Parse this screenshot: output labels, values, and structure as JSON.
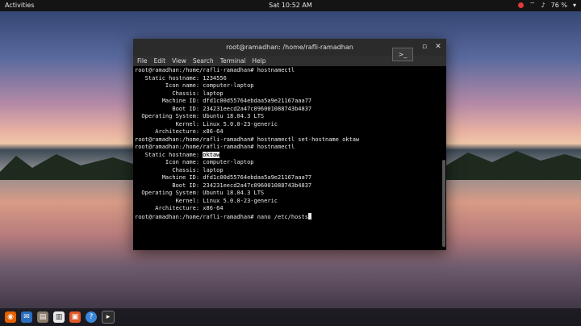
{
  "topbar": {
    "activities": "Activities",
    "clock": "Sat 10:52 AM",
    "battery": "76 %"
  },
  "window": {
    "title": "root@ramadhan: /home/rafli-ramadhan",
    "menu": [
      "File",
      "Edit",
      "View",
      "Search",
      "Terminal",
      "Help"
    ]
  },
  "terminal": {
    "lines": [
      "root@ramadhan:/home/rafli-ramadhan# hostnamectl",
      "   Static hostname: 1234556",
      "         Icon name: computer-laptop",
      "           Chassis: laptop",
      "        Machine ID: dfd1c00d55764ebdaa5a9e21167aaa77",
      "           Boot ID: 234231eecd2a47c096001088743b4837",
      "  Operating System: Ubuntu 18.04.3 LTS",
      "            Kernel: Linux 5.0.0-23-generic",
      "      Architecture: x86-64",
      "root@ramadhan:/home/rafli-ramadhan# hostnamectl set-hostname oktaw",
      "root@ramadhan:/home/rafli-ramadhan# hostnamectl"
    ],
    "static_label": "   Static hostname: ",
    "static_value": "oktaw",
    "lines2": [
      "         Icon name: computer-laptop",
      "           Chassis: laptop",
      "        Machine ID: dfd1c00d55764ebdaa5a9e21167aaa77",
      "           Boot ID: 234231eecd2a47c096001088743b4837",
      "  Operating System: Ubuntu 18.04.3 LTS",
      "            Kernel: Linux 5.0.0-23-generic",
      "      Architecture: x86-64"
    ],
    "last_prompt": "root@ramadhan:/home/rafli-ramadhan# nano /etc/hosts"
  },
  "dock": {
    "icons": [
      "firefox-icon",
      "thunderbird-icon",
      "files-icon",
      "libreoffice-icon",
      "software-icon",
      "help-icon",
      "terminal-icon"
    ]
  },
  "colors": {
    "terminal_bg": "#000000",
    "text": "#e8e8e8",
    "topbar": "#141414"
  }
}
